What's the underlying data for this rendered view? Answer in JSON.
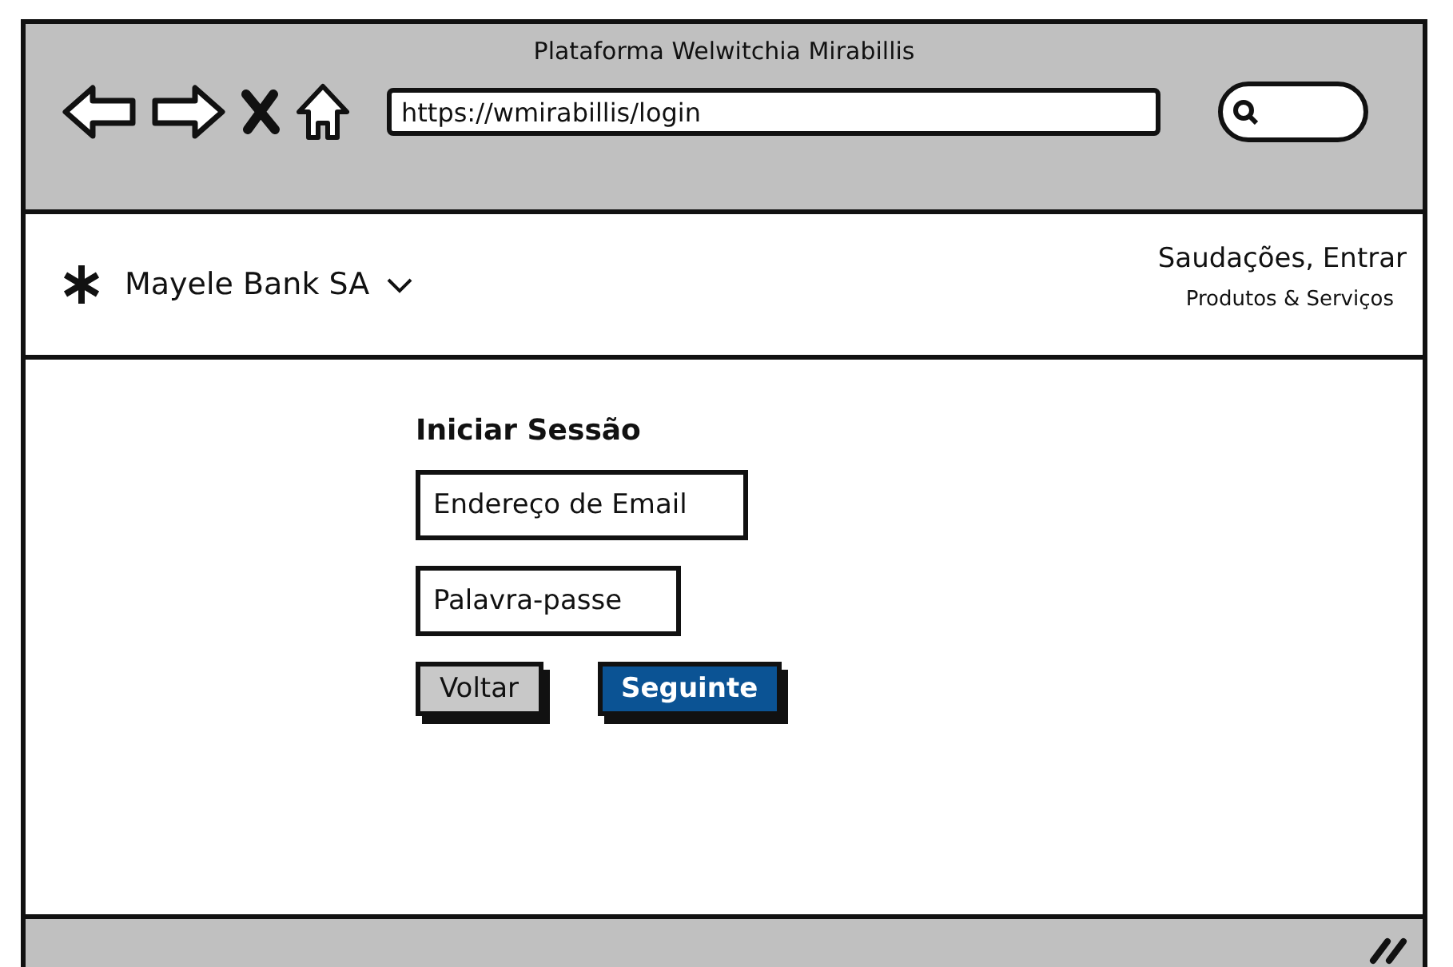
{
  "window": {
    "title": "Plataforma Welwitchia Mirabillis"
  },
  "address_bar": {
    "value": "https://wmirabillis/login"
  },
  "header": {
    "brand": "Mayele Bank SA",
    "greeting": "Saudações, Entrar",
    "menu": "Produtos & Serviços"
  },
  "login": {
    "title": "Iniciar Sessão",
    "fields": [
      {
        "value": "Endereço de Email"
      },
      {
        "value": "Palavra-passe"
      }
    ],
    "buttons": [
      {
        "label": "Voltar",
        "kind": "secondary"
      },
      {
        "label": "Seguinte",
        "kind": "primary"
      }
    ]
  }
}
